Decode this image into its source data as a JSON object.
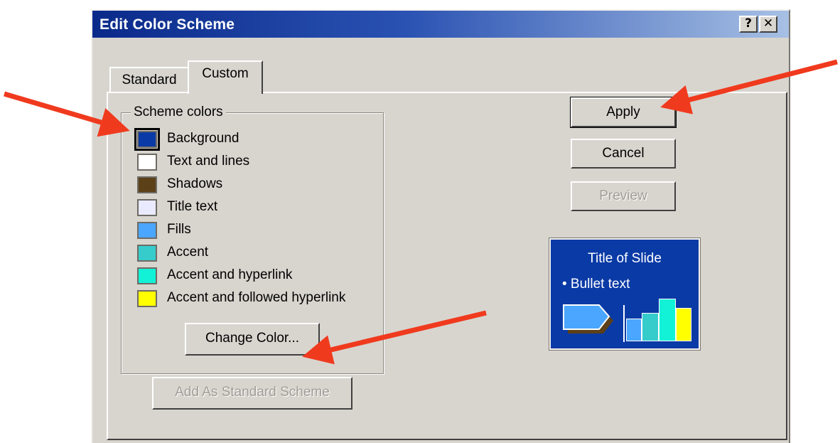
{
  "dialog": {
    "title": "Edit Color Scheme",
    "help_label": "?",
    "close_label": "✕"
  },
  "tabs": [
    {
      "label": "Standard",
      "active": false
    },
    {
      "label": "Custom",
      "active": true
    }
  ],
  "scheme_colors": {
    "label": "Scheme colors",
    "selected_index": 0,
    "items": [
      {
        "label": "Background",
        "color": "#0a3aa6"
      },
      {
        "label": "Text and lines",
        "color": "#ffffff"
      },
      {
        "label": "Shadows",
        "color": "#5c4018"
      },
      {
        "label": "Title text",
        "color": "#eaeaff"
      },
      {
        "label": "Fills",
        "color": "#4aa6ff"
      },
      {
        "label": "Accent",
        "color": "#36cccc"
      },
      {
        "label": "Accent and hyperlink",
        "color": "#12f2d6"
      },
      {
        "label": "Accent and followed hyperlink",
        "color": "#ffff00"
      }
    ]
  },
  "buttons": {
    "change_color": "Change Color...",
    "add_standard": "Add As Standard Scheme",
    "apply": "Apply",
    "cancel": "Cancel",
    "preview": "Preview"
  },
  "preview": {
    "title": "Title of Slide",
    "bullet": "•  Bullet text"
  },
  "annotation_color": "#f03a1e"
}
